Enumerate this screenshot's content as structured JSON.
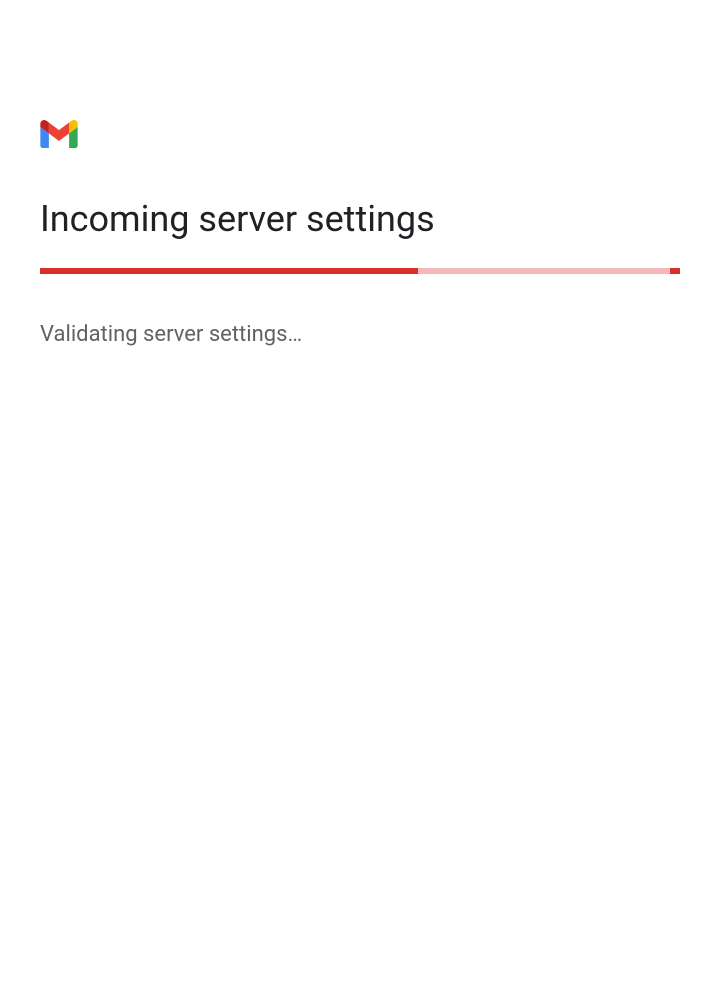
{
  "header": {
    "title": "Incoming server settings"
  },
  "status": {
    "message": "Validating server settings…"
  },
  "progress": {
    "percent": 59
  }
}
